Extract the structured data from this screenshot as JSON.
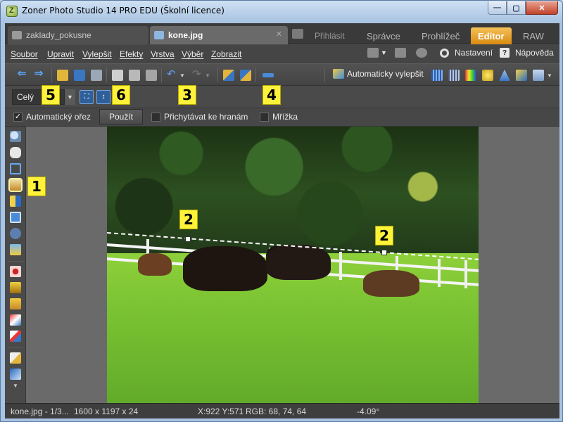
{
  "window": {
    "title": "Zoner Photo Studio 14 PRO EDU (Školní licence)"
  },
  "tabs": {
    "documents": [
      {
        "label": "zaklady_pokusne"
      },
      {
        "label": "kone.jpg",
        "close": "✕"
      }
    ],
    "modules": [
      {
        "label": "Přihlásit"
      },
      {
        "label": "Správce"
      },
      {
        "label": "Prohlížeč"
      },
      {
        "label": "Editor",
        "active": true
      },
      {
        "label": "RAW"
      }
    ]
  },
  "menu": {
    "items": [
      "Soubor",
      "Upravit",
      "Vylepšit",
      "Efekty",
      "Vrstva",
      "Výběr",
      "Zobrazit"
    ],
    "settings": "Nastavení",
    "help": "Nápověda"
  },
  "toolbar": {
    "auto_enhance": "Automaticky vylepšit"
  },
  "zoom": {
    "value": "Celý"
  },
  "options": {
    "auto_crop": {
      "label": "Automatický ořez",
      "checked": true
    },
    "apply": "Použít",
    "snap_edges": {
      "label": "Přichytávat ke hranám",
      "checked": false
    },
    "grid": {
      "label": "Mřížka",
      "checked": false
    }
  },
  "callouts": [
    "1",
    "2",
    "2",
    "3",
    "4",
    "5",
    "6"
  ],
  "status": {
    "file": "kone.jpg - 1/3...",
    "dimensions": "1600 x 1197 x 24",
    "coords": "X:922 Y:571",
    "rgb": "RGB: 68, 74, 64",
    "angle": "-4.09°"
  },
  "colors": {
    "active_module": "#e89a1a",
    "callout": "#fff23a"
  }
}
